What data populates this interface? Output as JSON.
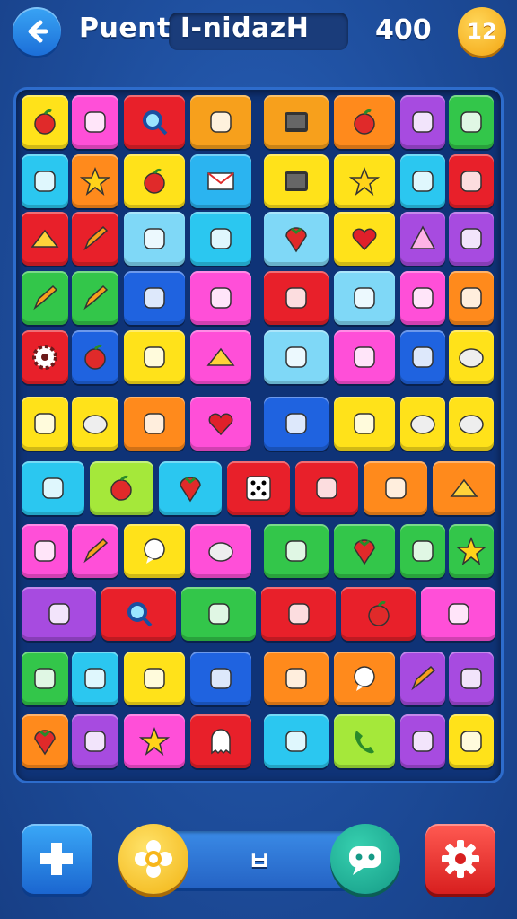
{
  "header": {
    "back_icon": "back-arrow-icon",
    "title": "Puent I-nidazH",
    "score": "400",
    "level": "12"
  },
  "board": {
    "tiles": [
      {
        "color": "#ffe21a",
        "icon": "apple-icon"
      },
      {
        "color": "#ff4fd8",
        "icon": "stone-icon"
      },
      {
        "color": "#e8202a",
        "icon": "magnifier-icon"
      },
      {
        "color": "#f7a01c",
        "icon": "fish-icon"
      },
      {
        "color": "#f7a01c",
        "icon": "tv-icon"
      },
      {
        "color": "#ff8a1c",
        "icon": "apple-icon"
      },
      {
        "color": "#a74be0",
        "icon": "jar-icon"
      },
      {
        "color": "#33c64a",
        "icon": "leaf-icon"
      },
      {
        "color": "#2bc7f0",
        "icon": "bottle-icon"
      },
      {
        "color": "#ff8a1c",
        "icon": "star-icon"
      },
      {
        "color": "#ffe21a",
        "icon": "apple-icon"
      },
      {
        "color": "#2bb4f0",
        "icon": "envelope-icon"
      },
      {
        "color": "#ffe21a",
        "icon": "tablet-icon"
      },
      {
        "color": "#ffe21a",
        "icon": "star-icon"
      },
      {
        "color": "#2bc7f0",
        "icon": "brush-icon"
      },
      {
        "color": "#e8202a",
        "icon": "mushroom-icon"
      },
      {
        "color": "#e8202a",
        "icon": "cheese-icon"
      },
      {
        "color": "#e8202a",
        "icon": "pencil-icon"
      },
      {
        "color": "#7fd8f7",
        "icon": "bandage-icon"
      },
      {
        "color": "#2bc7f0",
        "icon": "barrel-icon"
      },
      {
        "color": "#7fd8f7",
        "icon": "pepper-icon"
      },
      {
        "color": "#ffe21a",
        "icon": "heart-icon"
      },
      {
        "color": "#a74be0",
        "icon": "triangle-icon"
      },
      {
        "color": "#a74be0",
        "icon": "shell-icon"
      },
      {
        "color": "#33c64a",
        "icon": "carrot-icon"
      },
      {
        "color": "#33c64a",
        "icon": "pencil-icon"
      },
      {
        "color": "#1f63e0",
        "icon": "puzzle-icon"
      },
      {
        "color": "#ff4fd8",
        "icon": "box-icon"
      },
      {
        "color": "#e8202a",
        "icon": "cone-icon"
      },
      {
        "color": "#7fd8f7",
        "icon": "icecream-icon"
      },
      {
        "color": "#ff4fd8",
        "icon": "balloon-icon"
      },
      {
        "color": "#ff8a1c",
        "icon": "sausage-icon"
      },
      {
        "color": "#e8202a",
        "icon": "gear-icon"
      },
      {
        "color": "#1f63e0",
        "icon": "apple-icon"
      },
      {
        "color": "#ffe21a",
        "icon": "flag-icon"
      },
      {
        "color": "#ff4fd8",
        "icon": "cheese-icon"
      },
      {
        "color": "#7fd8f7",
        "icon": "bone-icon"
      },
      {
        "color": "#ff4fd8",
        "icon": "cake-icon"
      },
      {
        "color": "#1f63e0",
        "icon": "plant-icon"
      },
      {
        "color": "#ffe21a",
        "icon": "rock-icon"
      },
      {
        "color": "#ffe21a",
        "icon": "fan-icon"
      },
      {
        "color": "#ffe21a",
        "icon": "cloud-icon"
      },
      {
        "color": "#ff8a1c",
        "icon": "crate-icon"
      },
      {
        "color": "#ff4fd8",
        "icon": "heart-icon"
      },
      {
        "color": "#1f63e0",
        "icon": "tube-icon"
      },
      {
        "color": "#ffe21a",
        "icon": "clipboard-icon"
      },
      {
        "color": "#ffe21a",
        "icon": "rock-icon"
      },
      {
        "color": "#ffe21a",
        "icon": "rock-icon"
      },
      {
        "color": "#2bc7f0",
        "icon": "watermelon-icon"
      },
      {
        "color": "#a5e83a",
        "icon": "apple-icon"
      },
      {
        "color": "#2bc7f0",
        "icon": "strawberry-icon"
      },
      {
        "color": "#e8202a",
        "icon": "dice-icon"
      },
      {
        "color": "#e8202a",
        "icon": "arrow-icon"
      },
      {
        "color": "#ff8a1c",
        "icon": "melon-icon"
      },
      {
        "color": "#ff8a1c",
        "icon": "cheese-icon"
      },
      {
        "color": "#ff4fd8",
        "icon": "bandage-icon"
      },
      {
        "color": "#ff4fd8",
        "icon": "pencil-icon"
      },
      {
        "color": "#ffe21a",
        "icon": "speech-icon"
      },
      {
        "color": "#ff4fd8",
        "icon": "cookie-icon"
      },
      {
        "color": "#33c64a",
        "icon": "shell-icon"
      },
      {
        "color": "#33c64a",
        "icon": "pepper-icon"
      },
      {
        "color": "#33c64a",
        "icon": "tube-icon"
      },
      {
        "color": "#33c64a",
        "icon": "star-icon"
      },
      {
        "color": "#a74be0",
        "icon": "microwave-icon"
      },
      {
        "color": "#e8202a",
        "icon": "magnifier-icon"
      },
      {
        "color": "#33c64a",
        "icon": "gem-icon"
      },
      {
        "color": "#e8202a",
        "icon": "target-icon"
      },
      {
        "color": "#e8202a",
        "icon": "apple-icon"
      },
      {
        "color": "#ff4fd8",
        "icon": "ticket-icon"
      },
      {
        "color": "#33c64a",
        "icon": "book-icon"
      },
      {
        "color": "#2bc7f0",
        "icon": "key-icon"
      },
      {
        "color": "#ffe21a",
        "icon": "plant-icon"
      },
      {
        "color": "#1f63e0",
        "icon": "acorn-icon"
      },
      {
        "color": "#ff8a1c",
        "icon": "racket-icon"
      },
      {
        "color": "#ff8a1c",
        "icon": "speech-icon"
      },
      {
        "color": "#a74be0",
        "icon": "carrot-icon"
      },
      {
        "color": "#a74be0",
        "icon": "pickle-icon"
      },
      {
        "color": "#ff8a1c",
        "icon": "strawberry-icon"
      },
      {
        "color": "#a74be0",
        "icon": "pin-icon"
      },
      {
        "color": "#ff4fd8",
        "icon": "star-icon"
      },
      {
        "color": "#e8202a",
        "icon": "ghost-icon"
      },
      {
        "color": "#2bc7f0",
        "icon": "fish-icon"
      },
      {
        "color": "#a5e83a",
        "icon": "phone-icon"
      },
      {
        "color": "#a74be0",
        "icon": "jar-icon"
      },
      {
        "color": "#ffe21a",
        "icon": "banana-icon"
      }
    ]
  },
  "bottom_bar": {
    "left_icon": "plus-puzzle-icon",
    "center_left_icon": "flower-icon",
    "center_label": "ㅂ",
    "center_right_icon": "chat-icon",
    "right_icon": "gear-icon"
  }
}
